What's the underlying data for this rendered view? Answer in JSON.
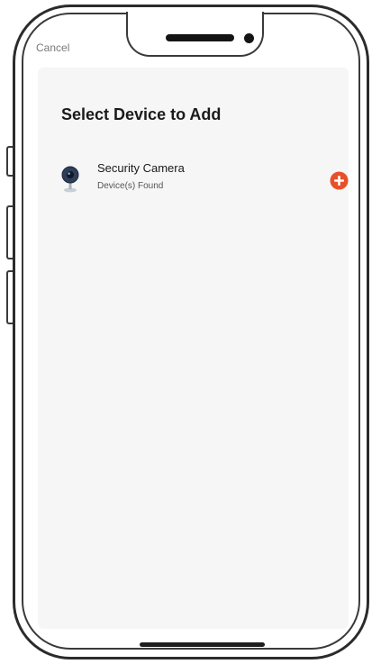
{
  "header": {
    "cancel_label": "Cancel",
    "title": "Select Device to Add"
  },
  "devices": [
    {
      "name": "Security Camera",
      "status": "Device(s) Found",
      "icon": "security-camera-icon",
      "action_icon": "plus-circle-icon"
    }
  ],
  "colors": {
    "accent": "#e8502a",
    "screen_background": "#f6f6f6",
    "phone_frame": "#2b2b2b"
  }
}
